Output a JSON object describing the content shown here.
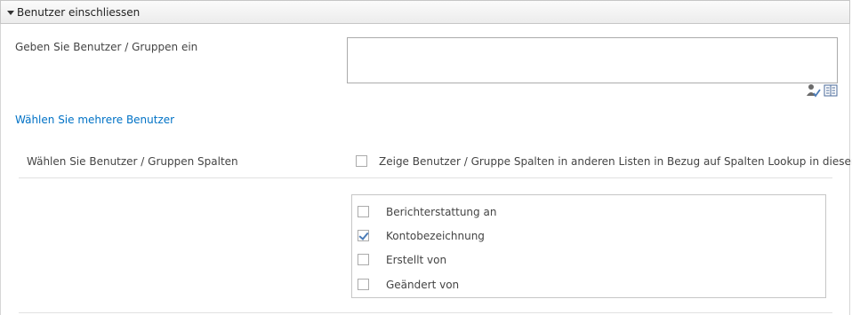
{
  "section": {
    "title": "Benutzer einschliessen"
  },
  "users_field": {
    "label": "Geben Sie Benutzer / Gruppen ein",
    "value": ""
  },
  "multi_link": "Wählen Sie mehrere Benutzer",
  "columns_label": "Wählen Sie Benutzer / Gruppen Spalten",
  "lookup_option": {
    "label": "Zeige Benutzer / Gruppe Spalten in anderen Listen in Bezug auf Spalten Lookup in dieser Liste",
    "checked": false
  },
  "columns": [
    {
      "label": "Berichterstattung an",
      "checked": false
    },
    {
      "label": "Kontobezeichnung",
      "checked": true
    },
    {
      "label": "Erstellt von",
      "checked": false
    },
    {
      "label": "Geändert von",
      "checked": false
    }
  ],
  "colors": {
    "link": "#0072c6",
    "check": "#4a7bb7"
  }
}
